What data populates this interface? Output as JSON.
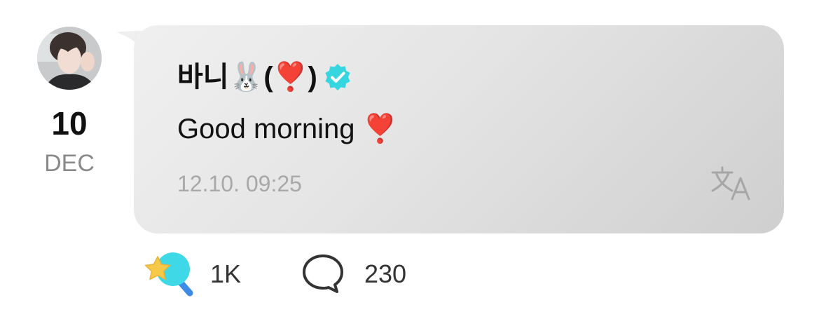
{
  "post": {
    "date": {
      "day": "10",
      "month": "DEC"
    },
    "author": {
      "name": "바니🐰(❣️)",
      "verified": true
    },
    "message": "Good morning ❣️",
    "timestamp": "12.10. 09:25"
  },
  "footer": {
    "reaction_count": "1K",
    "comment_count": "230"
  },
  "colors": {
    "verified_badge": "#35d6e0",
    "reaction_blue": "#3fd8e6",
    "reaction_star": "#f7c948",
    "timestamp_text": "#a8a8a8"
  },
  "icons": {
    "verified": "verified-badge-icon",
    "translate": "translate-icon",
    "reaction": "star-lollipop-icon",
    "comment": "speech-bubble-icon"
  }
}
